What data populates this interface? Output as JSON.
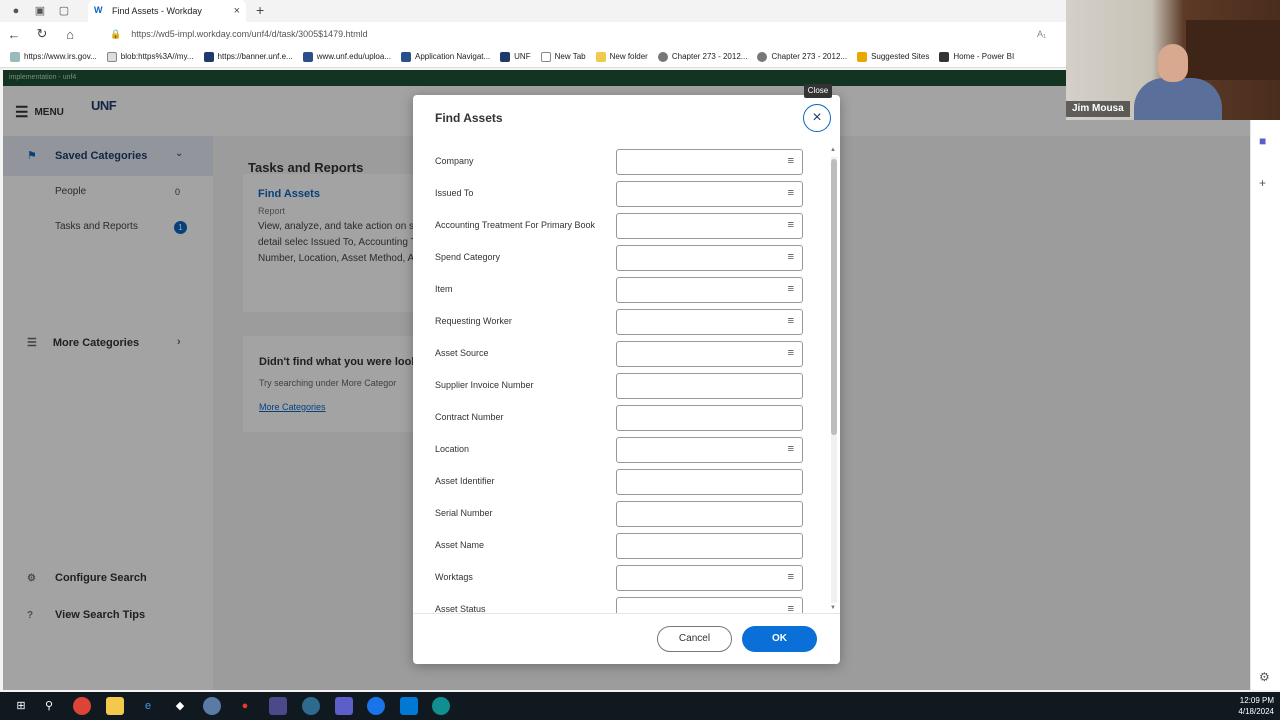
{
  "browser": {
    "tab_title": "Find Assets - Workday",
    "url": "https://wd5-impl.workday.com/unf4/d/task/3005$1479.htmld",
    "bookmarks": [
      "https://www.irs.gov...",
      "blob:https%3A//my...",
      "https://banner.unf.e...",
      "www.unf.edu/uploa...",
      "Application Navigat...",
      "UNF",
      "New Tab",
      "New folder",
      "Chapter 273 - 2012...",
      "Chapter 273 - 2012...",
      "Suggested Sites",
      "Home - Power BI"
    ]
  },
  "app": {
    "tenant_label": "implementation - unf4",
    "menu_label": "MENU",
    "logo_text": "UNF",
    "sidebar": {
      "saved_categories": "Saved Categories",
      "items": [
        {
          "label": "People",
          "count": "0"
        },
        {
          "label": "Tasks and Reports",
          "count": "1"
        }
      ],
      "more_categories": "More Categories",
      "configure_search": "Configure Search",
      "view_search_tips": "View Search Tips"
    },
    "main": {
      "title": "Tasks and Reports",
      "result_link": "Find Assets",
      "result_type": "Report",
      "result_desc": "View, analyze, and take action on set. View additional detail selec Issued To, Accounting Treatmen Invoice Number, Location, Asset Method, Acquisition Method, As",
      "notfound_title": "Didn't find what you were lookin",
      "notfound_sub": "Try searching under More Categor",
      "notfound_link": "More Categories"
    }
  },
  "modal": {
    "title": "Find Assets",
    "close_tooltip": "Close",
    "fields": [
      {
        "label": "Company",
        "prompt": true
      },
      {
        "label": "Issued To",
        "prompt": true
      },
      {
        "label": "Accounting Treatment For Primary Book",
        "prompt": true
      },
      {
        "label": "Spend Category",
        "prompt": true
      },
      {
        "label": "Item",
        "prompt": true
      },
      {
        "label": "Requesting Worker",
        "prompt": true
      },
      {
        "label": "Asset Source",
        "prompt": true
      },
      {
        "label": "Supplier Invoice Number",
        "prompt": false
      },
      {
        "label": "Contract Number",
        "prompt": false
      },
      {
        "label": "Location",
        "prompt": true
      },
      {
        "label": "Asset Identifier",
        "prompt": false
      },
      {
        "label": "Serial Number",
        "prompt": false
      },
      {
        "label": "Asset Name",
        "prompt": false
      },
      {
        "label": "Worktags",
        "prompt": true
      },
      {
        "label": "Asset Status",
        "prompt": true
      }
    ],
    "cancel_label": "Cancel",
    "ok_label": "OK"
  },
  "video": {
    "participant_name": "Jim Mousa"
  },
  "taskbar": {
    "time": "12:09 PM",
    "date": "4/18/2024"
  },
  "colors": {
    "primary_blue": "#0a6fd6",
    "workday_green": "#1f5232"
  }
}
